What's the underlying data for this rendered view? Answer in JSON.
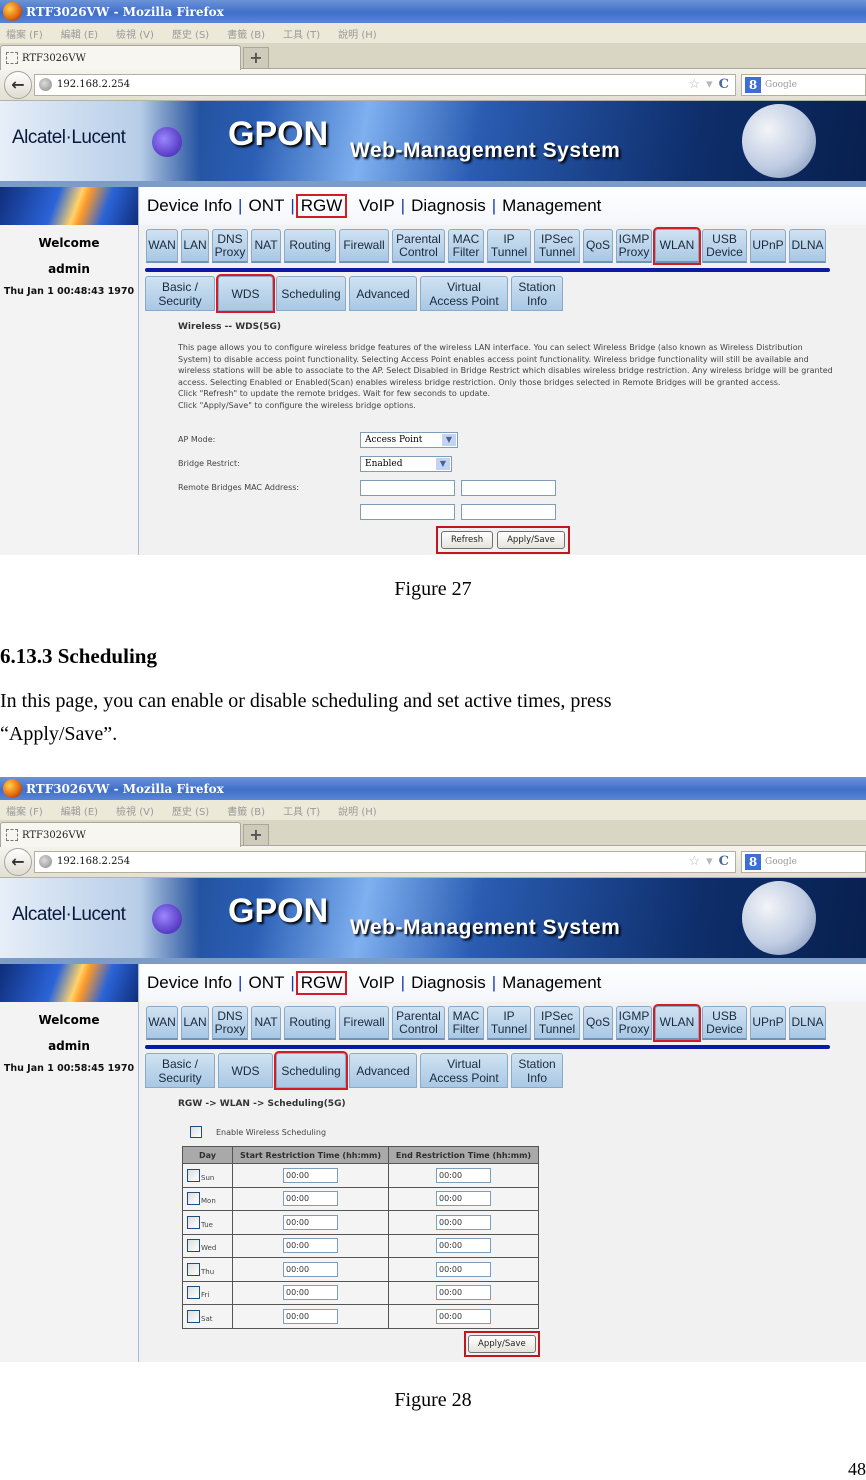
{
  "browser": {
    "window_title": "RTF3026VW - Mozilla Firefox",
    "menu": [
      "檔案 (F)",
      "編輯 (E)",
      "檢視 (V)",
      "歷史 (S)",
      "書籤 (B)",
      "工具 (T)",
      "說明 (H)"
    ],
    "tab_title": "RTF3026VW",
    "new_tab": "+",
    "back": "←",
    "url": "192.168.2.254",
    "star": "☆",
    "dropdown": "▾",
    "reload": "C",
    "search_engine_icon": "8",
    "search_placeholder": "Google"
  },
  "banner": {
    "brand": "Alcatel·Lucent",
    "product": "GPON",
    "subtitle": "Web-Management System"
  },
  "top_menu": [
    {
      "label": "Device Info"
    },
    {
      "label": "ONT"
    },
    {
      "label": "RGW",
      "highlighted": true
    },
    {
      "label": "VoIP"
    },
    {
      "label": "Diagnosis"
    },
    {
      "label": "Management"
    }
  ],
  "nav_tabs": [
    "WAN",
    "LAN",
    "DNS Proxy",
    "NAT",
    "Routing",
    "Firewall",
    "Parental Control",
    "MAC Filter",
    "IP Tunnel",
    "IPSec Tunnel",
    "QoS",
    "IGMP Proxy",
    "WLAN",
    "USB Device",
    "UPnP",
    "DLNA"
  ],
  "nav_tab_selected": "WLAN",
  "sub_tabs": [
    "Basic / Security",
    "WDS",
    "Scheduling",
    "Advanced",
    "Virtual Access Point",
    "Station Info"
  ],
  "sidebar": {
    "welcome": "Welcome",
    "user": "admin"
  },
  "figure27": {
    "time": "Thu Jan 1 00:48:43 1970",
    "selected_sub_tab": "WDS",
    "page_title": "Wireless -- WDS(5G)",
    "description": [
      "This page allows you to configure wireless bridge features of the wireless LAN interface. You can select Wireless Bridge (also known as Wireless Distribution",
      "System) to disable access point functionality. Selecting Access Point enables access point functionality. Wireless bridge functionality will still be available and",
      "wireless stations will be able to associate to the AP. Select Disabled in Bridge Restrict which disables wireless bridge restriction. Any wireless bridge will be granted",
      "access. Selecting Enabled or Enabled(Scan) enables wireless bridge restriction. Only those bridges selected in Remote Bridges will be granted access.",
      "Click \"Refresh\" to update the remote bridges. Wait for few seconds to update.",
      "Click \"Apply/Save\" to configure the wireless bridge options."
    ],
    "ap_mode_label": "AP Mode:",
    "ap_mode_value": "Access Point",
    "bridge_restrict_label": "Bridge Restrict:",
    "bridge_restrict_value": "Enabled",
    "remote_mac_label": "Remote Bridges MAC Address:",
    "remote_mac_values": [
      "",
      "",
      "",
      ""
    ],
    "refresh_button": "Refresh",
    "apply_button": "Apply/Save",
    "caption": "Figure 27"
  },
  "section": {
    "heading": "6.13.3  Scheduling",
    "paragraph_line1": "In this page, you can enable or disable scheduling and set active times, press",
    "paragraph_line2": "“Apply/Save”."
  },
  "figure28": {
    "time": "Thu Jan 1 00:58:45 1970",
    "selected_sub_tab": "Scheduling",
    "breadcrumb": "RGW -> WLAN -> Scheduling(5G)",
    "enable_label": "Enable Wireless Scheduling",
    "enable_checked": false,
    "table_headers": [
      "Day",
      "Start Restriction Time (hh:mm)",
      "End Restriction Time (hh:mm)"
    ],
    "rows": [
      {
        "day": "Sun",
        "checked": false,
        "start": "00:00",
        "end": "00:00"
      },
      {
        "day": "Mon",
        "checked": false,
        "start": "00:00",
        "end": "00:00"
      },
      {
        "day": "Tue",
        "checked": false,
        "start": "00:00",
        "end": "00:00"
      },
      {
        "day": "Wed",
        "checked": false,
        "start": "00:00",
        "end": "00:00"
      },
      {
        "day": "Thu",
        "checked": false,
        "start": "00:00",
        "end": "00:00"
      },
      {
        "day": "Fri",
        "checked": false,
        "start": "00:00",
        "end": "00:00"
      },
      {
        "day": "Sat",
        "checked": false,
        "start": "00:00",
        "end": "00:00"
      }
    ],
    "apply_button": "Apply/Save",
    "caption": "Figure 28"
  },
  "page_number": "48",
  "colors": {
    "highlight": "#d21d26",
    "nav_divider": "#0a1aa4",
    "tab_bg": "#b9d3ea",
    "title_bar": "#4a79cf"
  }
}
